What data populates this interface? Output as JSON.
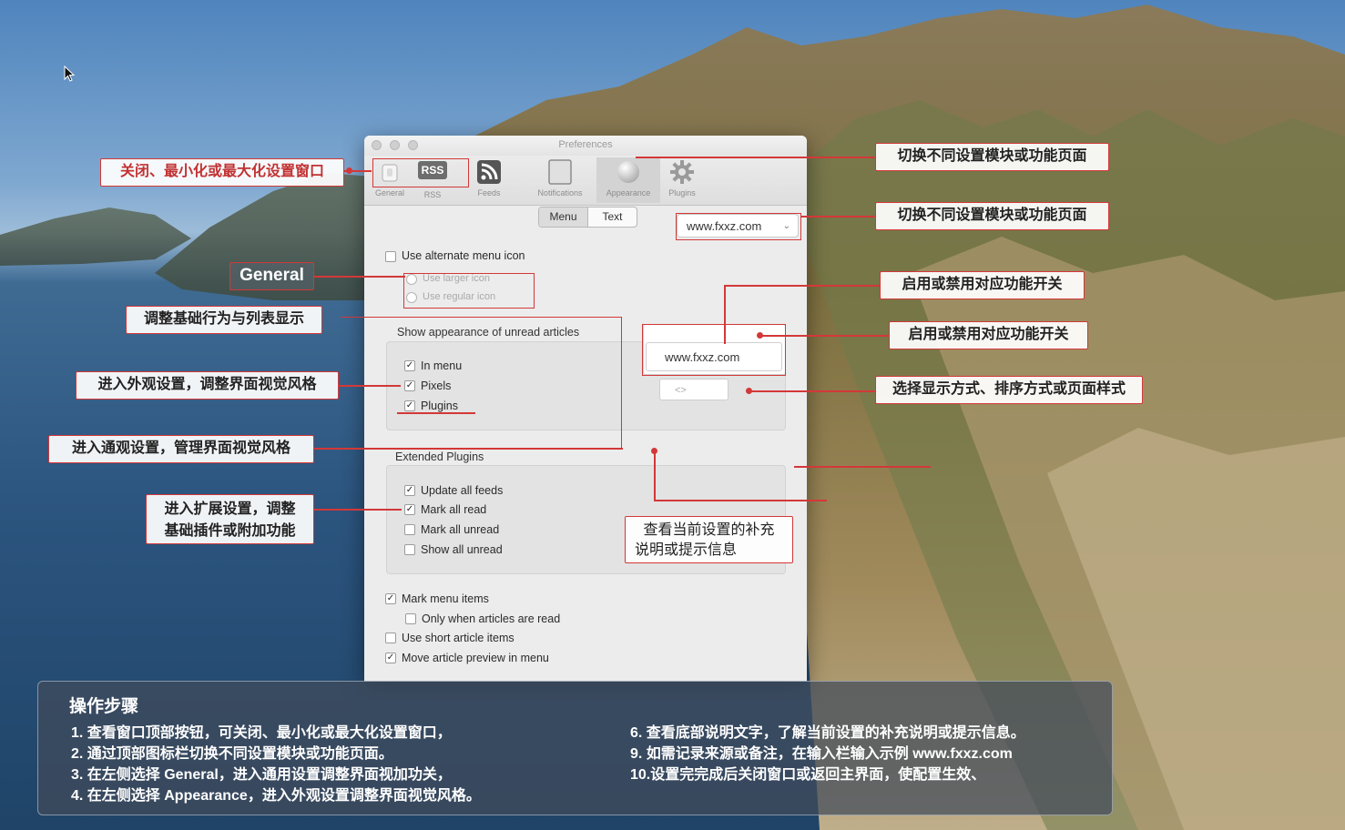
{
  "window": {
    "title": "Preferences",
    "toolbar_tabs": [
      {
        "label": "General",
        "icon": "general-icon"
      },
      {
        "label": "RSS",
        "icon": "rss-badge-icon"
      },
      {
        "label": "Feeds",
        "icon": "rss-feed-icon"
      },
      {
        "label": "Notifications",
        "icon": "notifications-icon"
      },
      {
        "label": "Appearance",
        "icon": "appearance-icon"
      },
      {
        "label": "Plugins",
        "icon": "gear-icon"
      }
    ],
    "rss_badge_text": "RSS",
    "segmented": [
      "Menu",
      "Text"
    ],
    "dropdown_value": "www.fxxz.com",
    "use_alternate_menu_icon": "Use alternate menu icon",
    "radio_options": [
      "Use larger icon",
      "Use regular icon"
    ],
    "section_unread_title": "Show appearance of unread articles",
    "unread_options": [
      {
        "label": "In menu",
        "checked": true
      },
      {
        "label": "Pixels",
        "checked": true
      },
      {
        "label": "Plugins",
        "checked": true
      }
    ],
    "url_field_value": "www.fxxz.com",
    "small_field_value": "<>",
    "section_extended_title": "Extended Plugins",
    "extended_options": [
      {
        "label": "Update all feeds",
        "checked": true
      },
      {
        "label": "Mark all read",
        "checked": true
      },
      {
        "label": "Mark all unread",
        "checked": false
      },
      {
        "label": "Show all unread",
        "checked": false
      }
    ],
    "bottom_options": [
      {
        "label": "Mark menu items",
        "checked": true
      },
      {
        "label": "Only when articles are read",
        "checked": false
      },
      {
        "label": "Use short article items",
        "checked": false
      },
      {
        "label": "Move article preview in menu",
        "checked": true
      }
    ]
  },
  "callouts": {
    "window_controls": "关闭、最小化或最大化设置窗口",
    "switch_modules_1": "切换不同设置模块或功能页面",
    "switch_modules_2": "切换不同设置模块或功能页面",
    "general": "General",
    "basic_behavior": "调整基础行为与列表显示",
    "toggle_1": "启用或禁用对应功能开关",
    "toggle_2": "启用或禁用对应功能开关",
    "appearance": "进入外观设置，调整界面视觉风格",
    "display_mode": "选择显示方式、排序方式或页面样式",
    "general_visual": "进入通观设置，管理界面视觉风格",
    "extension_line1": "进入扩展设置，调整",
    "extension_line2": "基础插件或附加功能",
    "info_line1": "查看当前设置的补充",
    "info_line2": "说明或提示信息"
  },
  "steps": {
    "title": "操作步骤",
    "left": [
      "1. 查看窗口顶部按钮，可关闭、最小化或最大化设置窗口，",
      "2. 通过顶部图标栏切换不同设置模块或功能页面。",
      "3. 在左侧选择 General，进入通用设置调整界面视加功关，",
      "4. 在左侧选择 Appearance，进入外观设置调整界面视觉风格。"
    ],
    "right": [
      "6. 查看底部说明文字，了解当前设置的补充说明或提示信息。",
      "9. 如需记录来源或备注，在输入栏输入示例 www.fxxz.com",
      "10.设置完完成后关闭窗口或返回主界面，使配置生效、"
    ]
  },
  "colors": {
    "callout_border": "#d33838",
    "window_bg": "#ececec"
  }
}
